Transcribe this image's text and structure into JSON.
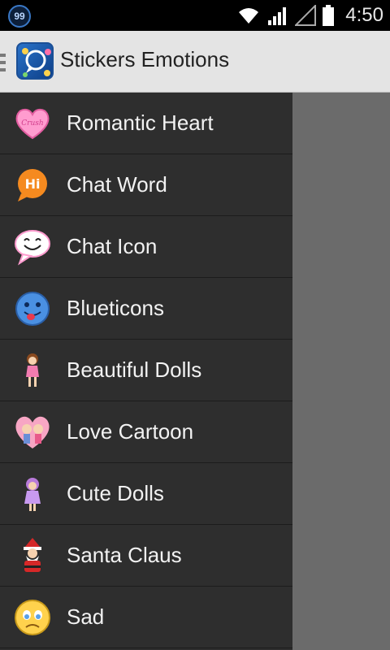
{
  "status_bar": {
    "notification_badge": "99",
    "time": "4:50"
  },
  "action_bar": {
    "title": "Stickers Emotions"
  },
  "drawer": {
    "items": [
      {
        "label": "Romantic Heart",
        "icon": "heart-crush-icon"
      },
      {
        "label": "Chat Word",
        "icon": "hi-bubble-icon"
      },
      {
        "label": "Chat Icon",
        "icon": "smile-bubble-icon"
      },
      {
        "label": "Blueticons",
        "icon": "blue-smiley-icon"
      },
      {
        "label": "Beautiful Dolls",
        "icon": "doll-icon"
      },
      {
        "label": "Love Cartoon",
        "icon": "love-cartoon-icon"
      },
      {
        "label": "Cute Dolls",
        "icon": "cute-doll-icon"
      },
      {
        "label": "Santa Claus",
        "icon": "santa-icon"
      },
      {
        "label": "Sad",
        "icon": "sad-face-icon"
      }
    ]
  }
}
